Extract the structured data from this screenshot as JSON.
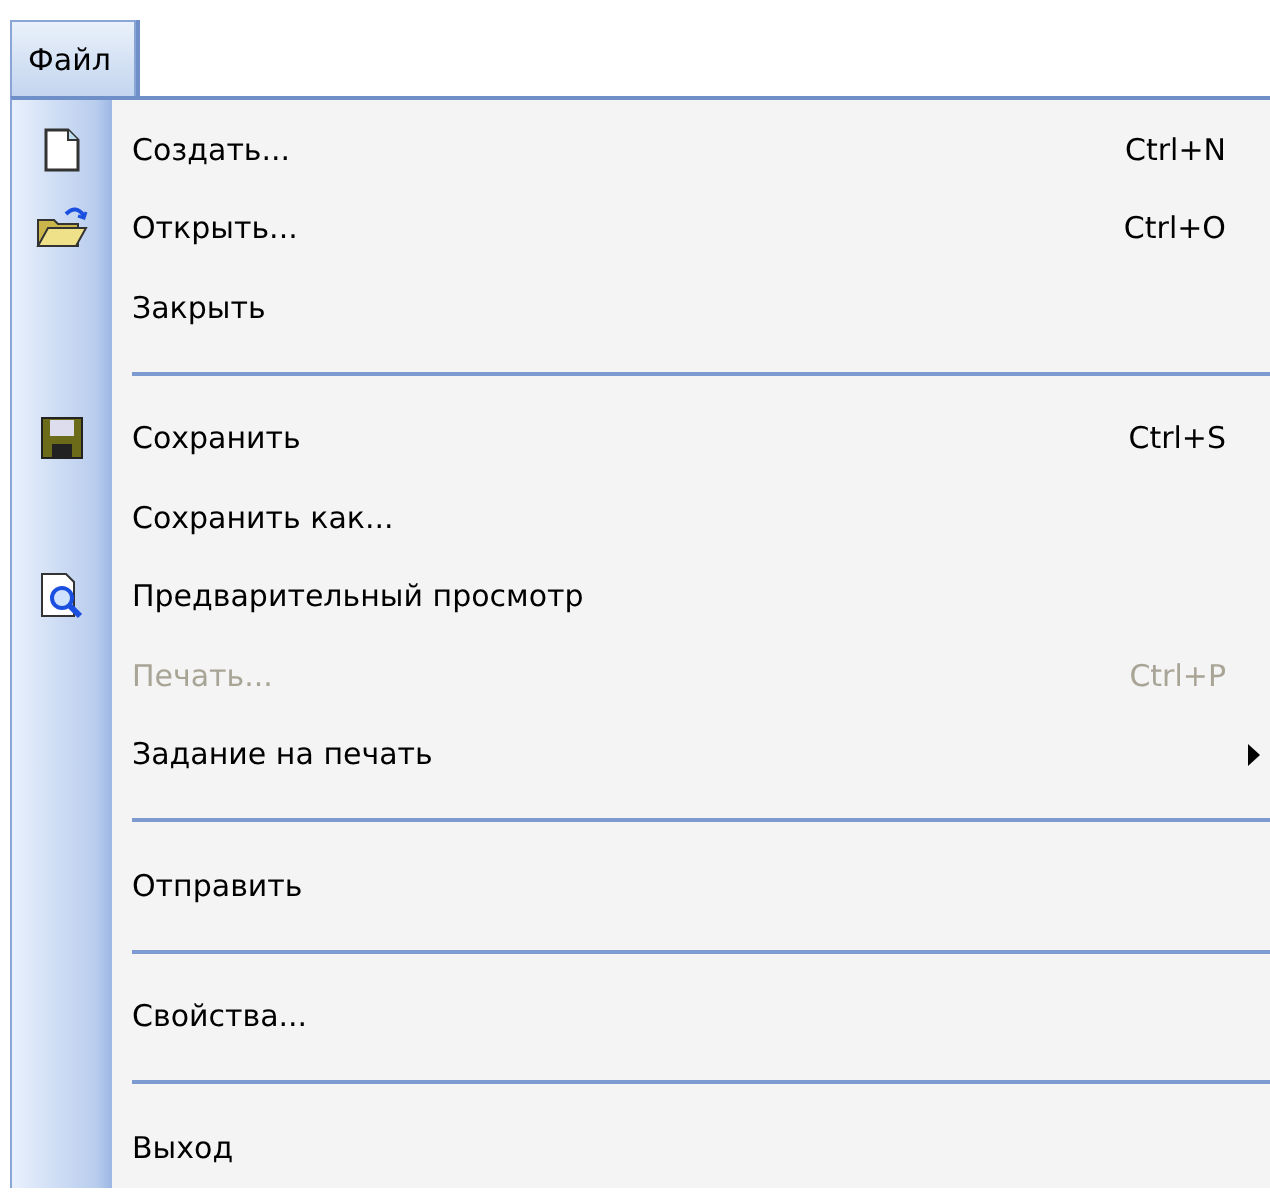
{
  "menu_bar": [
    {
      "label": "Файл",
      "selected": true
    }
  ],
  "menu": [
    {
      "kind": "document",
      "label": "Создать...",
      "shortcut": "Ctrl+N",
      "disabled": false,
      "submenu": false
    },
    {
      "kind": "folder",
      "label": "Открыть...",
      "shortcut": "Ctrl+O",
      "disabled": false,
      "submenu": false
    },
    {
      "kind": "plain",
      "label": "Закрыть",
      "disabled": false,
      "submenu": false
    },
    {
      "kind": "separator"
    },
    {
      "kind": "floppy",
      "label": "Сохранить",
      "shortcut": "Ctrl+S",
      "disabled": false,
      "submenu": false
    },
    {
      "kind": "plain",
      "label": "Сохранить как...",
      "disabled": false,
      "submenu": false
    },
    {
      "kind": "preview",
      "label": "Предварительный просмотр",
      "disabled": false,
      "submenu": false
    },
    {
      "kind": "plain",
      "label": "Печать...",
      "shortcut": "Ctrl+P",
      "disabled": true,
      "submenu": false
    },
    {
      "kind": "plain",
      "label": "Задание на печать",
      "disabled": false,
      "submenu": true
    },
    {
      "kind": "separator"
    },
    {
      "kind": "plain",
      "label": "Отправить",
      "disabled": false,
      "submenu": false
    },
    {
      "kind": "separator"
    },
    {
      "kind": "plain",
      "label": "Свойства...",
      "disabled": false,
      "submenu": false
    },
    {
      "kind": "separator"
    },
    {
      "kind": "plain",
      "label": "Выход",
      "disabled": false,
      "submenu": false
    }
  ]
}
